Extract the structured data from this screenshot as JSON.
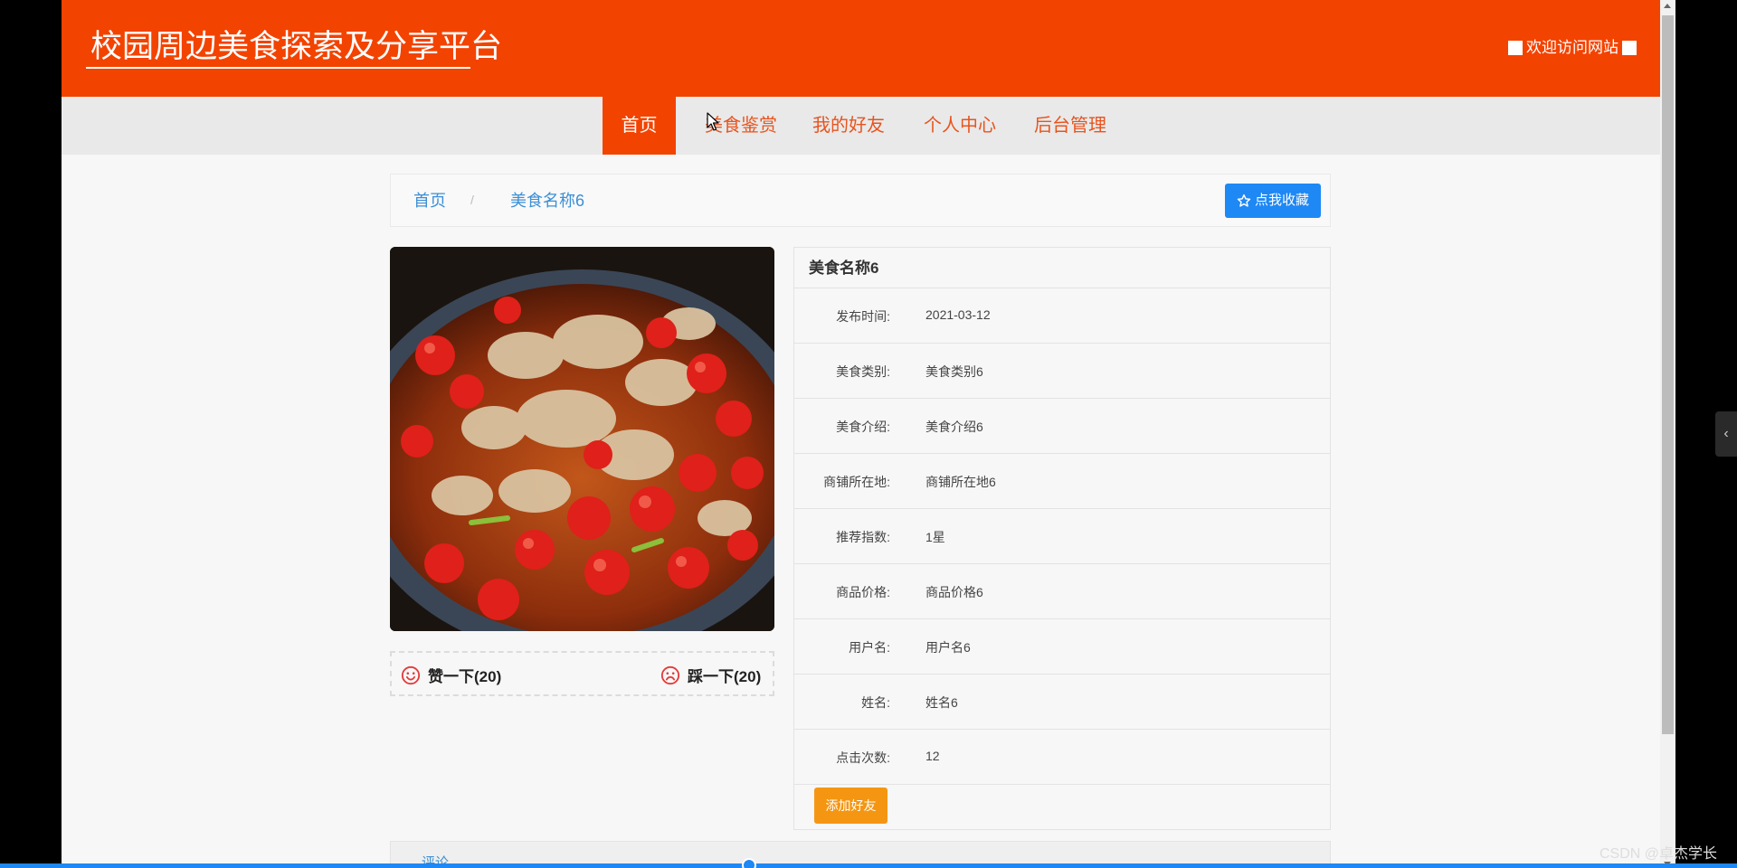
{
  "header": {
    "site_title": "校园周边美食探索及分享平台",
    "welcome_text": "欢迎访问网站"
  },
  "nav": {
    "items": [
      {
        "label": "首页",
        "active": true
      },
      {
        "label": "美食鉴赏",
        "active": false
      },
      {
        "label": "我的好友",
        "active": false
      },
      {
        "label": "个人中心",
        "active": false
      },
      {
        "label": "后台管理",
        "active": false
      }
    ]
  },
  "breadcrumb": {
    "home": "首页",
    "separator": "/",
    "current": "美食名称6"
  },
  "favorite_button": "点我收藏",
  "vote": {
    "like": "赞一下(20)",
    "dislike": "踩一下(20)"
  },
  "detail": {
    "title": "美食名称6",
    "rows": [
      {
        "label": "发布时间:",
        "value": "2021-03-12"
      },
      {
        "label": "美食类别:",
        "value": "美食类别6"
      },
      {
        "label": "美食介绍:",
        "value": "美食介绍6"
      },
      {
        "label": "商铺所在地:",
        "value": "商铺所在地6"
      },
      {
        "label": "推荐指数:",
        "value": "1星"
      },
      {
        "label": "商品价格:",
        "value": "商品价格6"
      },
      {
        "label": "用户名:",
        "value": "用户名6"
      },
      {
        "label": "姓名:",
        "value": "姓名6"
      },
      {
        "label": "点击次数:",
        "value": "12"
      }
    ],
    "add_friend": "添加好友"
  },
  "comment": {
    "label": "评论"
  },
  "watermark": "CSDN @卓杰学长",
  "colors": {
    "brand": "#f34300",
    "nav_bg": "#e9e9e9",
    "link": "#3b8fd6",
    "primary_button": "#1e88f5",
    "warning_button": "#f59612"
  }
}
